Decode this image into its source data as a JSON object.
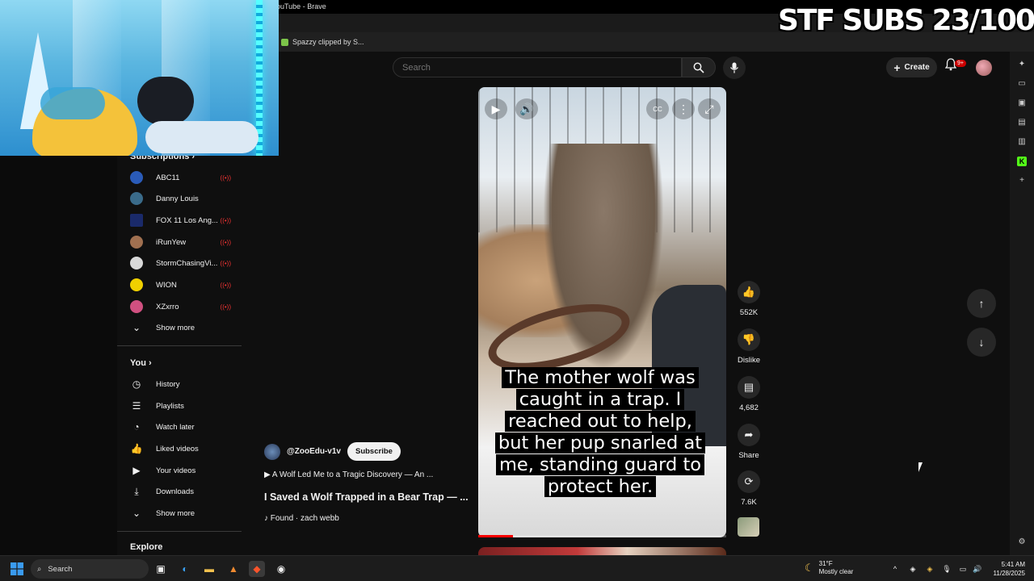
{
  "browser": {
    "window_title": "ouTube - Brave",
    "bookmark": "Spazzy clipped by S..."
  },
  "overlay": {
    "goal_text": "STF SUBS 23/100"
  },
  "header": {
    "search_placeholder": "Search",
    "create_label": "Create",
    "notification_count": "9+"
  },
  "sidebar": {
    "subscriptions_heading": "Subscriptions",
    "subscriptions": [
      {
        "label": "ABC11",
        "color": "#2a5bb8"
      },
      {
        "label": "Danny Louis",
        "color": "#3a6b8a"
      },
      {
        "label": "FOX 11 Los Ang...",
        "color": "#1a2a6a"
      },
      {
        "label": "iRunYew",
        "color": "#a07050"
      },
      {
        "label": "StormChasingVi...",
        "color": "#d8d8d8"
      },
      {
        "label": "WION",
        "color": "#f0d000"
      },
      {
        "label": "XZxrro",
        "color": "#d05080"
      }
    ],
    "show_more_1": "Show more",
    "you_heading": "You",
    "you_items": [
      {
        "label": "History",
        "icon": "history-icon",
        "glyph": "◷"
      },
      {
        "label": "Playlists",
        "icon": "playlists-icon",
        "glyph": "☰"
      },
      {
        "label": "Watch later",
        "icon": "watch-later-icon",
        "glyph": "◔"
      },
      {
        "label": "Liked videos",
        "icon": "like-icon",
        "glyph": "👍"
      },
      {
        "label": "Your videos",
        "icon": "your-videos-icon",
        "glyph": "▶"
      },
      {
        "label": "Downloads",
        "icon": "download-icon",
        "glyph": "⤓"
      }
    ],
    "show_more_2": "Show more",
    "explore_heading": "Explore"
  },
  "short": {
    "caption": "The mother wolf was caught in a trap. I reached out to help, but her pup snarled at me, standing guard to protect her.",
    "progress_fraction": 0.14,
    "channel_handle": "@ZooEdu-v1v",
    "subscribe_label": "Subscribe",
    "playlist_label": "▶  A Wolf Led Me to a Tragic Discovery — An ...",
    "title": "I Saved a Wolf Trapped in a Bear Trap — ...",
    "sound": "♪ Found · zach webb"
  },
  "actions": {
    "likes": "552K",
    "dislike": "Dislike",
    "comments": "4,682",
    "share": "Share",
    "remix": "7.6K"
  },
  "taskbar": {
    "search_label": "Search",
    "weather_temp": "31°F",
    "weather_desc": "Mostly clear",
    "time": "5:41 AM",
    "date": "11/28/2025"
  }
}
